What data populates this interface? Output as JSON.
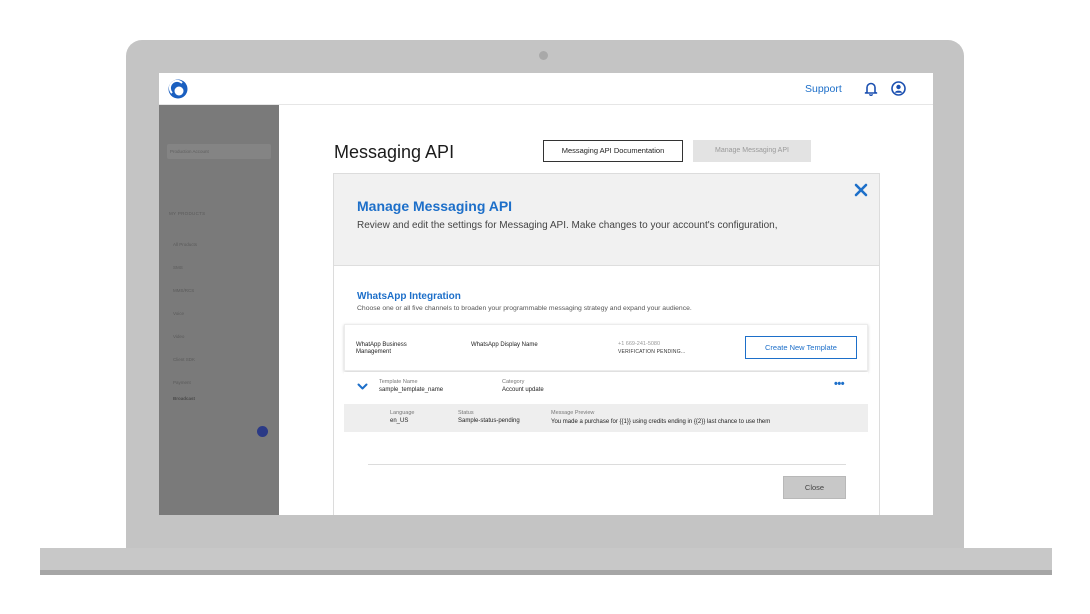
{
  "header": {
    "support_label": "Support"
  },
  "sidebar": {
    "account_label": "Production Account",
    "section_heading": "MY PRODUCTS",
    "items": [
      {
        "label": "All Products"
      },
      {
        "label": "SMS"
      },
      {
        "label": "MMS/RCS"
      },
      {
        "label": "Voice"
      },
      {
        "label": "Video"
      },
      {
        "label": "Client SDK"
      },
      {
        "label": "Payment"
      },
      {
        "label": "Broadcast"
      }
    ]
  },
  "page": {
    "title": "Messaging API",
    "doc_button": "Messaging API Documentation",
    "manage_button": "Manage Messaging API"
  },
  "modal": {
    "title": "Manage Messaging API",
    "subtitle": "Review and edit the settings for Messaging API. Make changes to your account's configuration,",
    "integration": {
      "title": "WhatsApp Integration",
      "subtitle": "Choose one or all five channels to broaden your programmable messaging strategy and expand your audience."
    },
    "card": {
      "business_management": "WhatApp Business Management",
      "display_name_label": "WhatsApp Display Name",
      "phone": "+1 669-241-5080",
      "verification_status": "VERIFICATION PENDING...",
      "create_button": "Create New Template"
    },
    "template": {
      "name_label": "Template Name",
      "name_value": "sample_template_name",
      "category_label": "Category",
      "category_value": "Account update",
      "more_label": "•••",
      "language_label": "Language",
      "language_value": "en_US",
      "status_label": "Status",
      "status_value": "Sample-status-pending",
      "preview_label": "Message Preview",
      "preview_value": "You made a purchase for {{1}} using credits ending in {{2}} last chance to use them"
    },
    "close_button": "Close"
  },
  "colors": {
    "accent": "#1d6fc9",
    "sidebar": "#7a7a7a",
    "laptop_frame": "#c4c4c4"
  }
}
